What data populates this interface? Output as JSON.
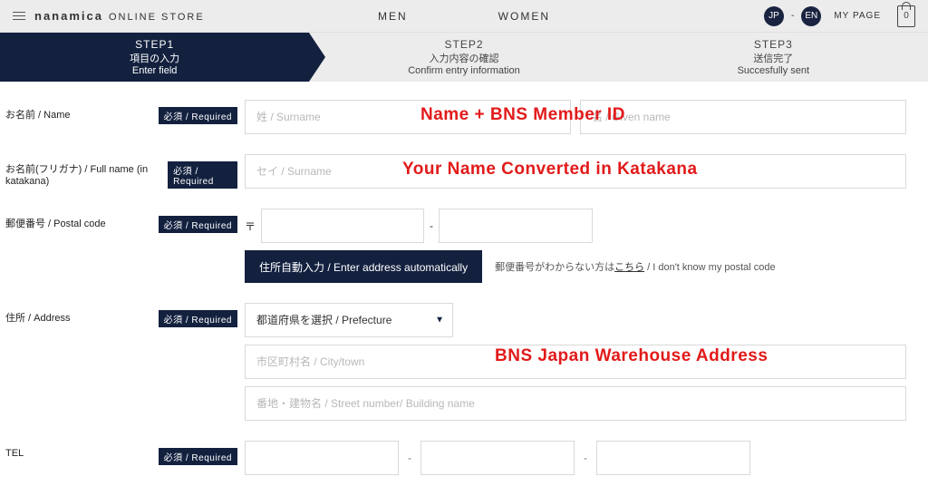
{
  "header": {
    "brand_bold": "nanamica",
    "brand_sub": "ONLINE STORE",
    "nav": {
      "men": "MEN",
      "women": "WOMEN"
    },
    "lang_jp": "JP",
    "lang_dash": "-",
    "lang_en": "EN",
    "mypage": "MY PAGE",
    "cart_count": "0"
  },
  "steps": [
    {
      "code": "STEP1",
      "jp": "項目の入力",
      "en": "Enter field"
    },
    {
      "code": "STEP2",
      "jp": "入力内容の確認",
      "en": "Confirm entry information"
    },
    {
      "code": "STEP3",
      "jp": "送信完了",
      "en": "Succesfully sent"
    }
  ],
  "required_badge": "必須 / Required",
  "fields": {
    "name": {
      "label": "お名前 / Name",
      "surname_ph": "姓 / Surname",
      "given_ph": "名 / Given name"
    },
    "kana": {
      "label": "お名前(フリガナ) / Full name (in katakana)",
      "surname_ph": "セイ / Surname"
    },
    "postal": {
      "label": "郵便番号 / Postal code",
      "prefix": "〒",
      "dash": "-",
      "auto_btn": "住所自動入力 / Enter address automatically",
      "helper_pre": "郵便番号がわからない方は",
      "helper_link": "こちら",
      "helper_post": " / I don't know my postal code"
    },
    "address": {
      "label": "住所 / Address",
      "prefecture_ph": "都道府県を選択 / Prefecture",
      "city_ph": "市区町村名 / City/town",
      "street_ph": "番地・建物名 / Street number/ Building name"
    },
    "tel": {
      "label": "TEL",
      "dash": "-"
    }
  },
  "annotations": {
    "name": "Name + BNS Member ID",
    "kana": "Your Name Converted in Katakana",
    "address": "BNS Japan Warehouse Address"
  }
}
